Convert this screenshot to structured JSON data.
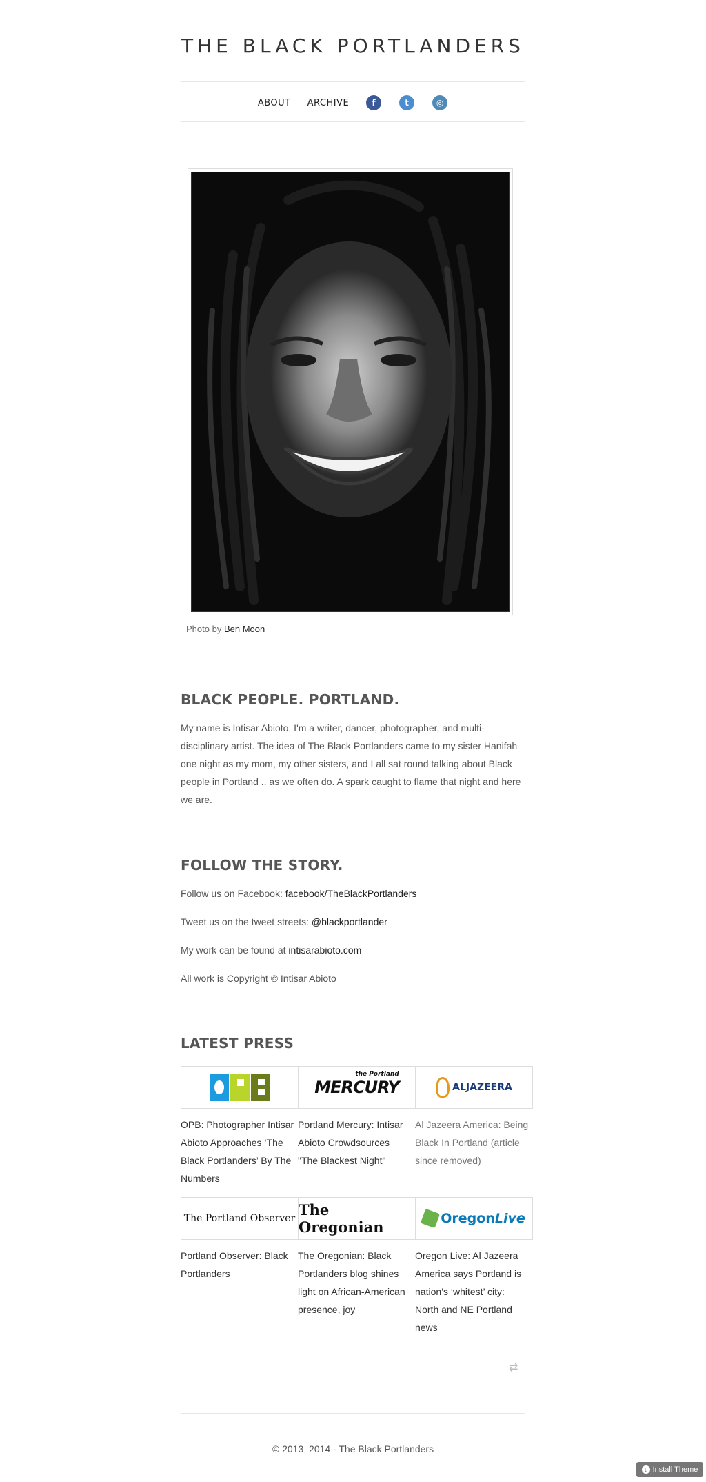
{
  "header": {
    "title": "THE BLACK PORTLANDERS",
    "nav": [
      {
        "label": "ABOUT"
      },
      {
        "label": "ARCHIVE"
      }
    ],
    "social": [
      {
        "icon": "facebook-icon",
        "glyph": "f",
        "color": "#3b5998"
      },
      {
        "icon": "twitter-icon",
        "glyph": "t",
        "color": "#4a8ed1"
      },
      {
        "icon": "instagram-icon",
        "glyph": "◎",
        "color": "#4f8bb8"
      }
    ]
  },
  "photo": {
    "caption_prefix": "Photo by",
    "caption_link": "Ben Moon"
  },
  "about": {
    "heading": "BLACK PEOPLE. PORTLAND.",
    "body": "My name is Intisar Abioto. I'm a writer, dancer, photographer, and multi-disciplinary artist. The idea of The Black Portlanders came to my sister Hanifah one night as my mom, my other sisters, and I all sat round talking about Black people in Portland .. as we often do. A spark caught to flame that night and here we are."
  },
  "follow": {
    "heading": "FOLLOW THE STORY.",
    "facebook_prefix": "Follow us on Facebook:",
    "facebook_link": "facebook/TheBlackPortlanders",
    "twitter_prefix": "Tweet us on the tweet streets:",
    "twitter_link": "@blackportlander",
    "work_prefix": "My work can be found at",
    "work_link": "intisarabioto.com",
    "copyright": "All work is Copyright © Intisar Abioto"
  },
  "press": {
    "heading": "LATEST PRESS",
    "items": [
      {
        "logo": "OPB",
        "text": "OPB: Photographer Intisar Abioto Approaches ‘The Black Portlanders’ By The Numbers"
      },
      {
        "logo": "the Portland MERCURY",
        "text": "Portland Mercury: Intisar Abioto Crowdsources \"The Blackest Night\""
      },
      {
        "logo": "ALJAZEERA",
        "text": "Al Jazeera America: Being Black In Portland (article since removed)"
      },
      {
        "logo": "The Portland Observer",
        "text": "Portland Observer: Black Portlanders"
      },
      {
        "logo": "The Oregonian",
        "text": "The Oregonian: Black Portlanders blog shines light on African-American presence, joy"
      },
      {
        "logo": "OregonLive",
        "text": "Oregon Live: Al Jazeera America says Portland is nation’s ‘whitest’ city: North and NE Portland news"
      }
    ]
  },
  "footer": {
    "text": "© 2013–2014 - The Black Portlanders",
    "install_label": "Install Theme"
  }
}
